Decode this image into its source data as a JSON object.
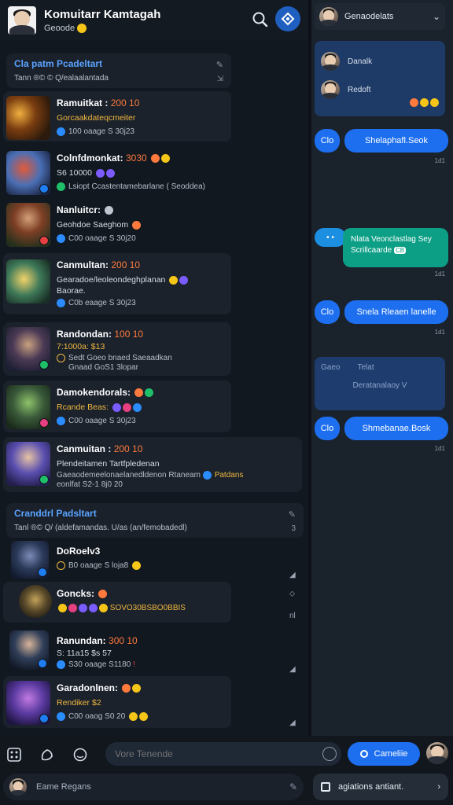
{
  "header": {
    "title": "Komuitarr Kamtagah",
    "subtitle": "Geoode"
  },
  "section1": {
    "title": "Cla patm Pcadeltart",
    "meta": "Tann  ®©  ©  Q/ealaalantada"
  },
  "section2": {
    "title": "Cranddrl Padsltart",
    "meta": "Tanl  ®©  Q/ (aldefamandas. U/as (an/femobadedl)",
    "side": "3"
  },
  "rows": [
    {
      "title": "Ramuitkat :",
      "score": "200 10",
      "line": "Gorcaakdateqcmeiter",
      "line_color": "orange",
      "meta": "100 oaage S 30j23"
    },
    {
      "title": "Colnfdmonkat:",
      "score": "3030",
      "line": "S6 10000",
      "line_color": "white",
      "meta": "Lsiopt Ccastentamebarlane ( Seoddea)"
    },
    {
      "title": "Nanluitcr:",
      "score": "",
      "line": "Geohdoe Saeghom",
      "line_color": "white",
      "meta": "C00 oaage S 30j20"
    },
    {
      "title": "Canmultan:",
      "score": "200 10",
      "line": "Gearadoe/leoleondeghplanan",
      "line2": "Baorae.",
      "line_color": "white",
      "meta": "C0b eaage S 30j23"
    },
    {
      "title": "Randondan:",
      "score": "100 10",
      "line": "7:1000a: $13",
      "line_color": "orange",
      "meta": "Sedt Goeo bnaed Saeaadkan",
      "meta2": "Gnaad GoS1 3lopar"
    },
    {
      "title": "Damokendorals:",
      "score": "",
      "line": "Rcande Beas:",
      "line_color": "orange",
      "meta": "C00 oaage S 30j23"
    },
    {
      "title": "Canmuitan :",
      "score": "200 10",
      "line": "Plendeitamen Tartfpledenan",
      "line_color": "white",
      "meta": "Gaeaodemeelonaelanedldenon Rtaneam",
      "meta_tag": "Patdans",
      "meta2": "eonlfat S2-1 8j0 20"
    },
    {
      "title": "DoRoelv3",
      "score": "",
      "line": "",
      "line_color": "white",
      "meta": "B0 oaage S loja8"
    },
    {
      "title": "Goncks:",
      "score": "",
      "line": "",
      "line_color": "white",
      "meta": "SOVO30BSBO0BBIS"
    },
    {
      "title": "Ranundan:",
      "score": "300 10",
      "line": "S: 11a15 $s 57",
      "line_color": "white",
      "meta": "S30 oaage S1180"
    },
    {
      "title": "Garadonlnen:",
      "score": "",
      "line": "Rendiker $2",
      "line_color": "orange",
      "meta": "C00 oaog S0 20"
    }
  ],
  "side_icons": {
    "a": "s2",
    "b": "nl"
  },
  "right": {
    "contact_selector": "Genaodelats",
    "contacts": [
      "Danalk",
      "Redoft"
    ],
    "messages": [
      {
        "tag": "Clo",
        "text": "Shelaphafl.Seok",
        "time": "1d1"
      },
      {
        "tag": "Clo",
        "text": "Snela Rleaen lanelle",
        "time": "1d1"
      },
      {
        "tag": "Clo",
        "text": "Shmebanae.Bosk",
        "time": "1d1"
      }
    ],
    "green_message": {
      "tag": "Clo",
      "text": "Nlata Veonclastlag Sey Scrillcaarde",
      "badge": "CB",
      "time": "1d1"
    },
    "dim_panel": {
      "a": "Gaeo",
      "b": "Telat",
      "c": "Deratanalaoy V"
    }
  },
  "composer": {
    "placeholder": "Vore Tenende",
    "send_label": "Cameliie"
  },
  "status_bar": {
    "placeholder": "Eame Regans",
    "activity_label": "agiations antiant."
  },
  "colors": {
    "accent": "#1d6ff0",
    "score": "#ff7a3c",
    "highlight": "#f0b73e",
    "green": "#0d9f86"
  }
}
